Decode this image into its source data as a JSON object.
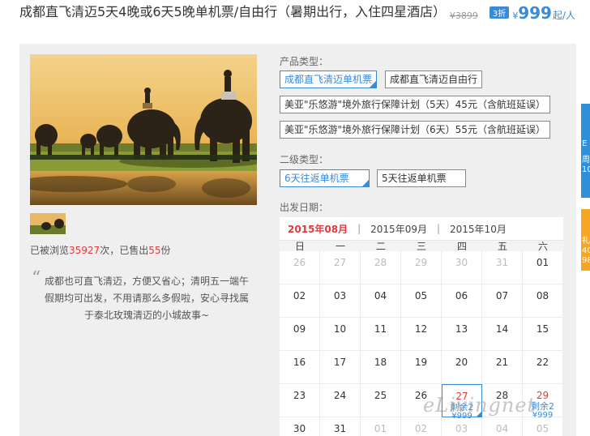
{
  "product": {
    "title": "成都直飞清迈5天4晚或6天5晚单机票/自由行（暑期出行，入住四星酒店）",
    "price_old": "¥3899",
    "discount_badge": "3折",
    "currency": "¥",
    "price": "999",
    "price_unit": "起/人"
  },
  "stats": {
    "prefix": "已被浏览",
    "views": "35927",
    "middle": "次，已售出",
    "sold": "55",
    "suffix": "份"
  },
  "quote": {
    "text": "成都也可直飞清迈，方便又省心；清明五一端午假期均可出发，不用请那么多假啦，安心寻找属于泰北玫瑰清迈的小城故事~"
  },
  "product_type": {
    "label": "产品类型：",
    "options": [
      "成都直飞清迈单机票",
      "成都直飞清迈自由行",
      "美亚\"乐悠游\"境外旅行保障计划（5天）45元（含航班延误）",
      "美亚\"乐悠游\"境外旅行保障计划（6天）55元（含航班延误）"
    ]
  },
  "sub_type": {
    "label": "二级类型：",
    "options": [
      "6天往返单机票",
      "5天往返单机票"
    ]
  },
  "departure": {
    "label": "出发日期："
  },
  "calendar": {
    "months": [
      "2015年08月",
      "2015年09月",
      "2015年10月"
    ],
    "sep": "|",
    "weekdays": [
      "日",
      "一",
      "二",
      "三",
      "四",
      "五",
      "六"
    ],
    "rows": [
      [
        "26",
        "27",
        "28",
        "29",
        "30",
        "31",
        "01"
      ],
      [
        "02",
        "03",
        "04",
        "05",
        "06",
        "07",
        "08"
      ],
      [
        "09",
        "10",
        "11",
        "12",
        "13",
        "14",
        "15"
      ],
      [
        "16",
        "17",
        "18",
        "19",
        "20",
        "21",
        "22"
      ],
      [
        "23",
        "24",
        "25",
        "26",
        "27",
        "28",
        "29"
      ],
      [
        "30",
        "31",
        "01",
        "02",
        "03",
        "04",
        "05"
      ]
    ],
    "avail_27": {
      "remain": "剩余2",
      "price": "¥999"
    },
    "avail_29": {
      "remain": "剩余2",
      "price": "¥999"
    }
  },
  "side_tabs": {
    "blue": [
      "E",
      "周",
      "10"
    ],
    "orange": [
      "礼",
      "40",
      "98"
    ]
  },
  "watermark": "eLivingnet",
  "colors": {
    "accent_blue": "#3b8ad8",
    "highlight_red": "#e4393c",
    "panel_bg": "#efefef"
  }
}
